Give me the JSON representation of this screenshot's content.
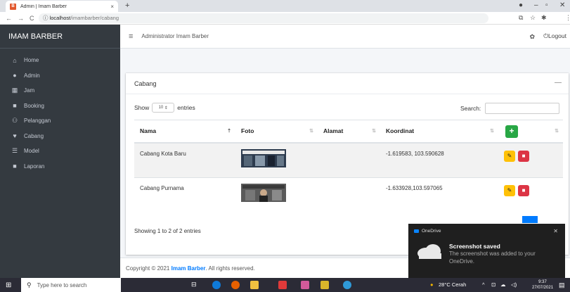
{
  "browser": {
    "tab_title": "Admin | Imam Barber",
    "tab_close": "×",
    "new_tab": "+",
    "url_host": "localhost",
    "url_path": "/imambarber/cabang",
    "favicon": "B"
  },
  "sidebar": {
    "brand": "IMAM BARBER",
    "items": [
      {
        "label": "Home",
        "icon": "home-icon",
        "glyph": "⌂"
      },
      {
        "label": "Admin",
        "icon": "user-icon",
        "glyph": "●"
      },
      {
        "label": "Jam",
        "icon": "table-icon",
        "glyph": "▦"
      },
      {
        "label": "Booking",
        "icon": "file-icon",
        "glyph": "■"
      },
      {
        "label": "Pelanggan",
        "icon": "users-icon",
        "glyph": "⚇"
      },
      {
        "label": "Cabang",
        "icon": "map-marker-icon",
        "glyph": "♥"
      },
      {
        "label": "Model",
        "icon": "list-icon",
        "glyph": "☰"
      },
      {
        "label": "Laporan",
        "icon": "file-icon",
        "glyph": "■"
      }
    ]
  },
  "topbar": {
    "title": "Administrator Imam Barber",
    "logout": "Logout"
  },
  "card": {
    "title": "Cabang",
    "show_label": "Show",
    "entries_value": "10",
    "entries_label": "entries",
    "search_label": "Search:",
    "columns": [
      "Nama",
      "Foto",
      "Alamat",
      "Koordinat"
    ],
    "add_label": "+",
    "rows": [
      {
        "nama": "Cabang Kota Baru",
        "alamat": "",
        "koordinat": "-1.619583, 103.590628"
      },
      {
        "nama": "Cabang Purnama",
        "alamat": "",
        "koordinat": "-1.633928,103.597065"
      }
    ],
    "info": "Showing 1 to 2 of 2 entries"
  },
  "footer": {
    "prefix": "Copyright © 2021 ",
    "brand": "Imam Barber",
    "suffix": ". All rights reserved."
  },
  "toast": {
    "app": "OneDrive",
    "title": "Screenshot saved",
    "body": "The screenshot was added to your OneDrive."
  },
  "taskbar": {
    "search_placeholder": "Type here to search",
    "weather": "28°C  Cerah",
    "time": "9:37",
    "date": "27/07/2021"
  },
  "colors": {
    "sidebar": "#343a40",
    "primary": "#007bff",
    "success": "#28a745",
    "warning": "#ffc107",
    "danger": "#dc3545"
  }
}
